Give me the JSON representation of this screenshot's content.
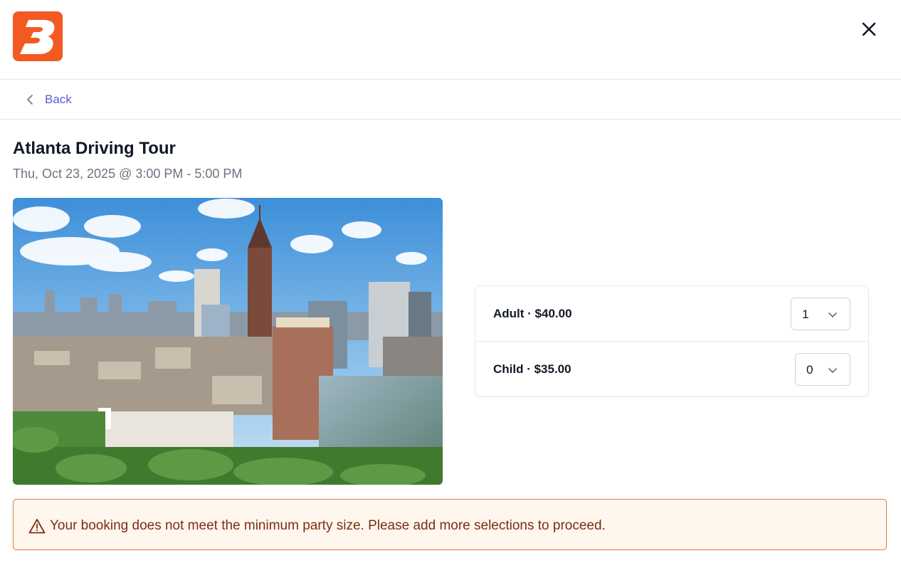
{
  "brand": {
    "logo_letter": "B",
    "accent_color": "#f25a22",
    "logo_icon": "brand-b-logo"
  },
  "header": {
    "close_icon": "close-icon"
  },
  "nav": {
    "back_label": "Back",
    "back_icon": "chevron-left-icon",
    "link_color": "#5b5bd6"
  },
  "event": {
    "title": "Atlanta Driving Tour",
    "datetime": "Thu, Oct 23, 2025 @ 3:00 PM - 5:00 PM",
    "image_subject": "Atlanta city skyline"
  },
  "tickets": [
    {
      "label": "Adult · $40.00",
      "quantity": "1",
      "icon": "chevron-down-icon"
    },
    {
      "label": "Child · $35.00",
      "quantity": "0",
      "icon": "chevron-down-icon"
    }
  ],
  "alert": {
    "icon": "warning-triangle-icon",
    "message": "Your booking does not meet the minimum party size. Please add more selections to proceed.",
    "background": "#fff7ed",
    "border": "#d97a3a",
    "text_color": "#7c2d12"
  }
}
